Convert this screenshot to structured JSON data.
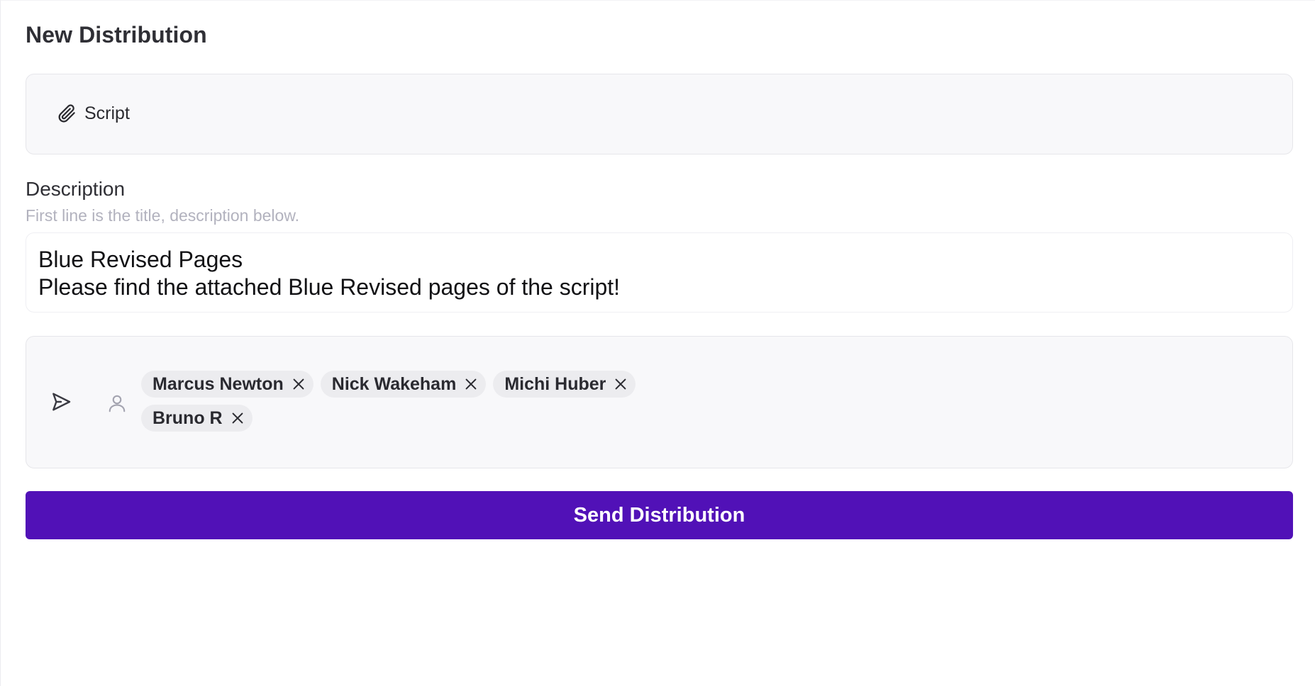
{
  "page": {
    "title": "New Distribution"
  },
  "attachment": {
    "icon": "paperclip-icon",
    "label": "Script"
  },
  "description": {
    "label": "Description",
    "help": "First line is the title, description below.",
    "value": "Blue Revised Pages\nPlease find the attached Blue Revised pages of the script!"
  },
  "recipients": {
    "send_icon": "send-icon",
    "user_icon": "user-icon",
    "chips": [
      {
        "name": "Marcus Newton"
      },
      {
        "name": "Nick Wakeham"
      },
      {
        "name": "Michi Huber"
      },
      {
        "name": "Bruno R"
      }
    ]
  },
  "actions": {
    "send_label": "Send Distribution"
  },
  "colors": {
    "accent": "#5111b7",
    "panel_bg": "#f8f8fa",
    "chip_bg": "#ececef",
    "help_text": "#b2b2be"
  }
}
